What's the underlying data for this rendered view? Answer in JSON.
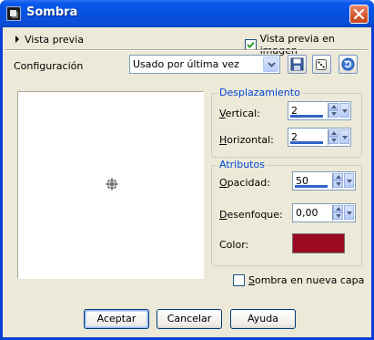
{
  "window": {
    "title": "Sombra",
    "icons": {
      "app": "dialog-app-icon",
      "close": "close-icon"
    }
  },
  "top_row": {
    "preview_toggle_label": "Vista previa",
    "preview_in_image": {
      "label": "Vista previa en imagen",
      "checked": true
    }
  },
  "config": {
    "label": "Configuración",
    "selected": "Usado por última vez",
    "icons": [
      "save-icon",
      "dice-icon",
      "reset-icon"
    ]
  },
  "displacement": {
    "title": "Desplazamiento",
    "vertical": {
      "label_u": "V",
      "label_rest": "ertical:",
      "value": "2"
    },
    "horizontal": {
      "label_u": "H",
      "label_rest": "orizontal:",
      "value": "2"
    }
  },
  "attributes": {
    "title": "Atributos",
    "opacity": {
      "label_u": "O",
      "label_rest": "pacidad:",
      "value": "50"
    },
    "blur": {
      "label_u": "D",
      "label_rest": "esenfoque:",
      "value": "0,00"
    },
    "color": {
      "label": "Color:",
      "value": "#9b0a22"
    }
  },
  "new_layer": {
    "label_u": "S",
    "label_rest": "ombra en nueva capa",
    "checked": false
  },
  "buttons": {
    "ok": "Aceptar",
    "cancel": "Cancelar",
    "help": "Ayuda"
  },
  "colors": {
    "title_bar": "#0a58ea",
    "accent": "#0046d5",
    "face": "#ece9d8"
  }
}
